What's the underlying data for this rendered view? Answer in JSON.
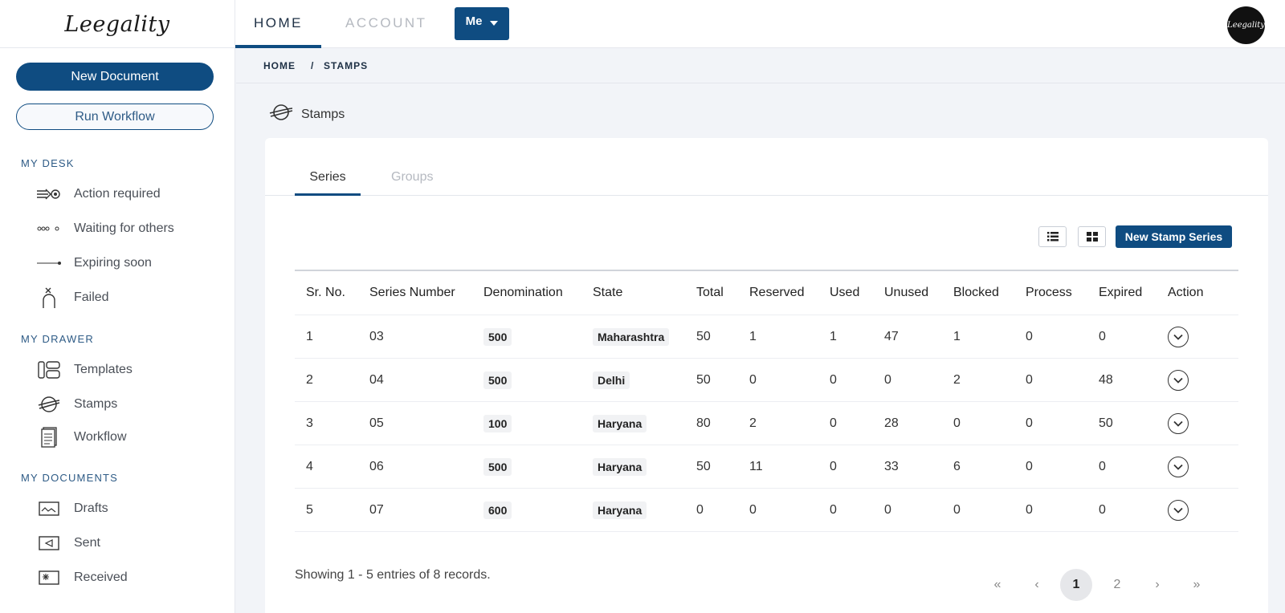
{
  "app": {
    "logo": "Leegality",
    "avatar_text": "Leegality"
  },
  "nav": {
    "home": "HOME",
    "account": "ACCOUNT",
    "me": "Me"
  },
  "sidebar": {
    "new_document": "New Document",
    "run_workflow": "Run Workflow",
    "my_desk": {
      "title": "MY DESK",
      "items": [
        {
          "label": "Action required",
          "icon": "action-required-icon"
        },
        {
          "label": "Waiting for others",
          "icon": "waiting-icon"
        },
        {
          "label": "Expiring soon",
          "icon": "expiring-icon"
        },
        {
          "label": "Failed",
          "icon": "failed-icon"
        }
      ]
    },
    "my_drawer": {
      "title": "MY DRAWER",
      "items": [
        {
          "label": "Templates",
          "icon": "templates-icon"
        },
        {
          "label": "Stamps",
          "icon": "stamps-icon"
        },
        {
          "label": "Workflow",
          "icon": "workflow-icon"
        }
      ]
    },
    "my_documents": {
      "title": "MY DOCUMENTS",
      "items": [
        {
          "label": "Drafts",
          "icon": "drafts-icon"
        },
        {
          "label": "Sent",
          "icon": "sent-icon"
        },
        {
          "label": "Received",
          "icon": "received-icon"
        }
      ]
    }
  },
  "breadcrumb": {
    "home": "HOME",
    "separator": "/",
    "current": "STAMPS"
  },
  "page": {
    "title": "Stamps"
  },
  "tabs": {
    "series": "Series",
    "groups": "Groups"
  },
  "toolbar": {
    "new_stamp_series": "New Stamp Series"
  },
  "table": {
    "headers": [
      "Sr. No.",
      "Series Number",
      "Denomination",
      "State",
      "Total",
      "Reserved",
      "Used",
      "Unused",
      "Blocked",
      "Process",
      "Expired",
      "Action"
    ],
    "rows": [
      {
        "sr": "1",
        "series": "03",
        "denomination": "500",
        "state": "Maharashtra",
        "total": "50",
        "reserved": "1",
        "used": "1",
        "unused": "47",
        "blocked": "1",
        "process": "0",
        "expired": "0"
      },
      {
        "sr": "2",
        "series": "04",
        "denomination": "500",
        "state": "Delhi",
        "total": "50",
        "reserved": "0",
        "used": "0",
        "unused": "0",
        "blocked": "2",
        "process": "0",
        "expired": "48"
      },
      {
        "sr": "3",
        "series": "05",
        "denomination": "100",
        "state": "Haryana",
        "total": "80",
        "reserved": "2",
        "used": "0",
        "unused": "28",
        "blocked": "0",
        "process": "0",
        "expired": "50"
      },
      {
        "sr": "4",
        "series": "06",
        "denomination": "500",
        "state": "Haryana",
        "total": "50",
        "reserved": "11",
        "used": "0",
        "unused": "33",
        "blocked": "6",
        "process": "0",
        "expired": "0"
      },
      {
        "sr": "5",
        "series": "07",
        "denomination": "600",
        "state": "Haryana",
        "total": "0",
        "reserved": "0",
        "used": "0",
        "unused": "0",
        "blocked": "0",
        "process": "0",
        "expired": "0"
      }
    ]
  },
  "footer": {
    "showing": "Showing 1 - 5 entries of 8 records."
  },
  "pagination": {
    "first": "«",
    "prev": "‹",
    "pages": [
      "1",
      "2"
    ],
    "next": "›",
    "last": "»",
    "current": "1"
  }
}
